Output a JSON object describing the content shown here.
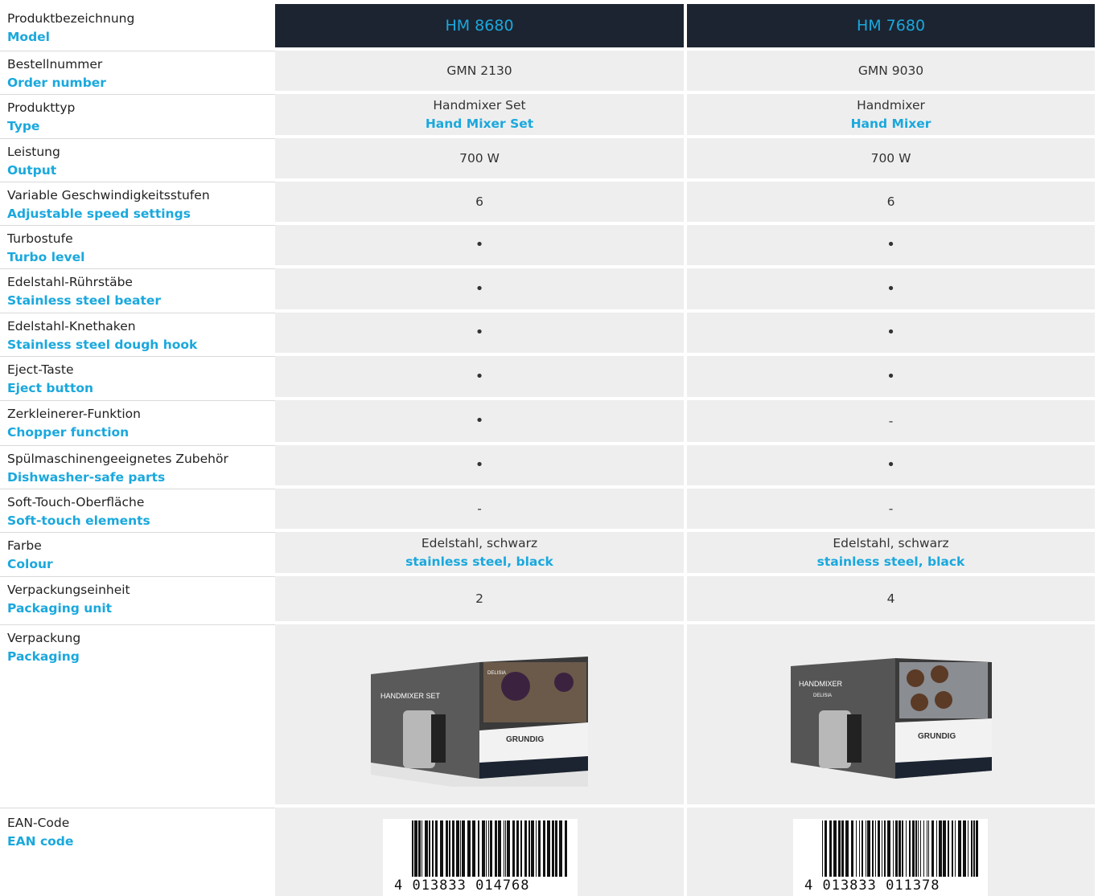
{
  "header": {
    "label_de": "Produktbezeichnung",
    "label_en": "Model",
    "model_1": "HM 8680",
    "model_2": "HM 7680"
  },
  "rows": [
    {
      "de": "Bestellnummer",
      "en": "Order number",
      "v1": "GMN 2130",
      "v2": "GMN 9030"
    },
    {
      "de": "Produkttyp",
      "en": "Type",
      "v1": "Handmixer Set",
      "v1_en": "Hand Mixer Set",
      "v2": "Handmixer",
      "v2_en": "Hand Mixer"
    },
    {
      "de": "Leistung",
      "en": "Output",
      "v1": "700 W",
      "v2": "700 W"
    },
    {
      "de": "Variable Geschwindigkeitsstufen",
      "en": "Adjustable speed settings",
      "v1": "6",
      "v2": "6"
    },
    {
      "de": "Turbostufe",
      "en": "Turbo level",
      "v1": "•",
      "v2": "•"
    },
    {
      "de": "Edelstahl-Rührstäbe",
      "en": "Stainless steel beater",
      "v1": "•",
      "v2": "•"
    },
    {
      "de": "Edelstahl-Knethaken",
      "en": "Stainless steel dough hook",
      "v1": "•",
      "v2": "•"
    },
    {
      "de": "Eject-Taste",
      "en": "Eject button",
      "v1": "•",
      "v2": "•"
    },
    {
      "de": "Zerkleinerer-Funktion",
      "en": "Chopper function",
      "v1": "•",
      "v2": "-"
    },
    {
      "de": "Spülmaschinengeeignetes Zubehör",
      "en": "Dishwasher-safe parts",
      "v1": "•",
      "v2": "•"
    },
    {
      "de": "Soft-Touch-Oberfläche",
      "en": "Soft-touch elements",
      "v1": "-",
      "v2": "-"
    },
    {
      "de": "Farbe",
      "en": "Colour",
      "v1": "Edelstahl, schwarz",
      "v1_en": "stainless steel, black",
      "v2": "Edelstahl, schwarz",
      "v2_en": "stainless steel, black"
    },
    {
      "de": "Verpackungseinheit",
      "en": "Packaging unit",
      "v1": "2",
      "v2": "4"
    }
  ],
  "packaging": {
    "de": "Verpackung",
    "en": "Packaging",
    "box1_title": "HANDMIXER SET",
    "box2_title": "HANDMIXER",
    "brand": "GRUNDIG",
    "sub_brand": "DELISIA"
  },
  "ean": {
    "de": "EAN-Code",
    "en": "EAN code",
    "code_1": "4 013833 014768",
    "code_2": "4 013833 011378"
  },
  "colors": {
    "accent": "#1aa8dd",
    "header_bg": "#1c2431",
    "cell_bg": "#eeeeee"
  }
}
